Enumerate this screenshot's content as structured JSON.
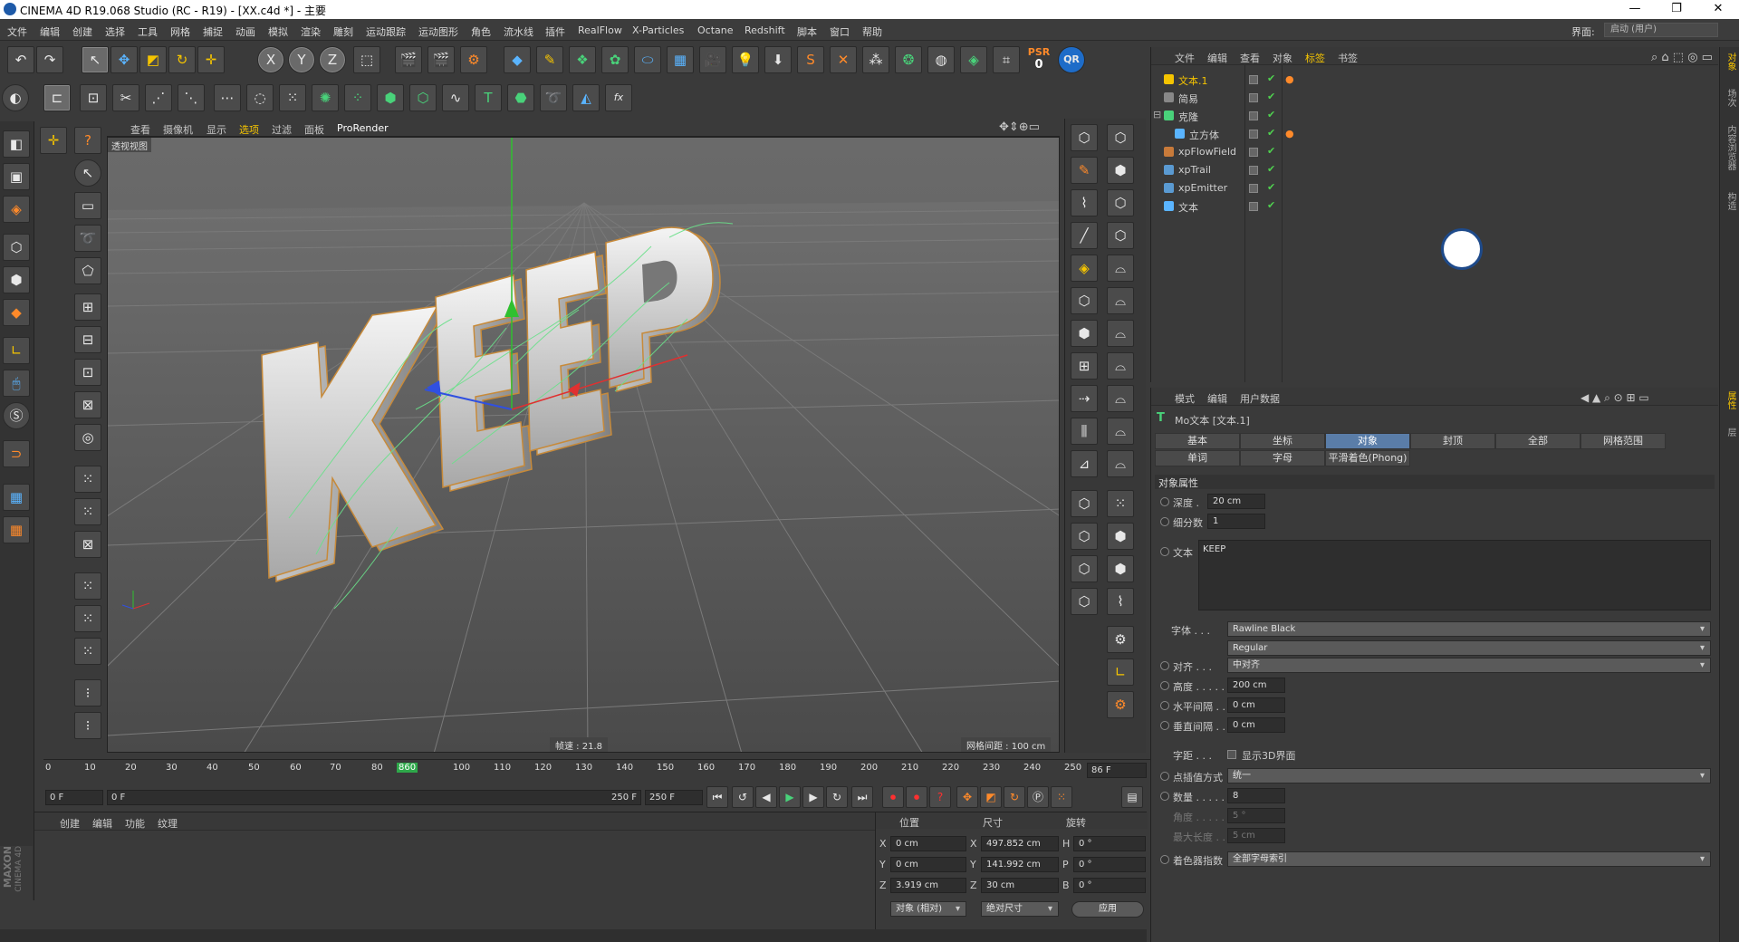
{
  "window": {
    "title": "CINEMA 4D R19.068 Studio (RC - R19) - [XX.c4d *] - 主要"
  },
  "menu": [
    "文件",
    "编辑",
    "创建",
    "选择",
    "工具",
    "网格",
    "捕捉",
    "动画",
    "模拟",
    "渲染",
    "雕刻",
    "运动跟踪",
    "运动图形",
    "角色",
    "流水线",
    "插件",
    "RealFlow",
    "X-Particles",
    "Octane",
    "Redshift",
    "脚本",
    "窗口",
    "帮助"
  ],
  "layout": {
    "label": "界面:",
    "value": "启动 (用户)"
  },
  "toolbar": {
    "psr_label": "PSR",
    "psr_value": "0",
    "qr_label": "QR",
    "x": "X",
    "y": "Y",
    "z": "Z",
    "s": "S",
    "t": "T",
    "fx": "fx"
  },
  "viewport": {
    "menu": [
      "查看",
      "摄像机",
      "显示",
      "选项",
      "过滤",
      "面板",
      "ProRender"
    ],
    "name": "透视视图",
    "fps": "帧速 : 21.8",
    "grid": "网格间距 : 100 cm",
    "text3d": "KEEP"
  },
  "timeline": {
    "ticks": [
      "0",
      "10",
      "20",
      "30",
      "40",
      "50",
      "60",
      "70",
      "80",
      "860",
      "100",
      "110",
      "120",
      "130",
      "140",
      "150",
      "160",
      "170",
      "180",
      "190",
      "200",
      "210",
      "220",
      "230",
      "240",
      "250"
    ],
    "current_frame": "86 F",
    "start": "0 F",
    "range_start": "0 F",
    "range_end": "250 F",
    "end": "250 F"
  },
  "materials": {
    "menu": [
      "创建",
      "编辑",
      "功能",
      "纹理"
    ]
  },
  "brand": {
    "line1": "MAXON",
    "line2": "CINEMA 4D"
  },
  "coords": {
    "headers": [
      "位置",
      "尺寸",
      "旋转"
    ],
    "rows": [
      {
        "pl": "X",
        "pv": "0 cm",
        "sl": "X",
        "sv": "497.852 cm",
        "rl": "H",
        "rv": "0 °"
      },
      {
        "pl": "Y",
        "pv": "0 cm",
        "sl": "Y",
        "sv": "141.992 cm",
        "rl": "P",
        "rv": "0 °"
      },
      {
        "pl": "Z",
        "pv": "3.919 cm",
        "sl": "Z",
        "sv": "30 cm",
        "rl": "B",
        "rv": "0 °"
      }
    ],
    "mode": "对象 (相对)",
    "size_mode": "绝对尺寸",
    "apply": "应用"
  },
  "objects": {
    "menu": [
      "文件",
      "编辑",
      "查看",
      "对象",
      "标签",
      "书签"
    ],
    "rows": [
      {
        "name": "文本.1",
        "highlight": true,
        "color": "#f5c400"
      },
      {
        "name": "简易",
        "highlight": false,
        "color": "#888888"
      },
      {
        "name": "克隆",
        "highlight": false,
        "color": "#49d27a"
      },
      {
        "name": "立方体",
        "highlight": false,
        "color": "#5ab4ff"
      },
      {
        "name": "xpFlowField",
        "highlight": false,
        "color": "#c87a3a"
      },
      {
        "name": "xpTrail",
        "highlight": false,
        "color": "#5a9ad2"
      },
      {
        "name": "xpEmitter",
        "highlight": false,
        "color": "#5a9ad2"
      },
      {
        "name": "文本",
        "highlight": false,
        "color": "#5ab4ff"
      }
    ]
  },
  "attributes": {
    "menu": [
      "模式",
      "编辑",
      "用户数据"
    ],
    "object_title": "Mo文本 [文本.1]",
    "tabs_row1": [
      "基本",
      "坐标",
      "对象",
      "封顶",
      "全部",
      "网格范围"
    ],
    "tabs_row2": [
      "单词",
      "字母",
      "平滑着色(Phong)"
    ],
    "section": "对象属性",
    "depth_label": "深度 .",
    "depth": "20 cm",
    "subdiv_label": "细分数",
    "subdiv": "1",
    "text_label": "文本",
    "text": "KEEP",
    "font_label": "字体 . . .",
    "font": "Rawline Black",
    "font_style": "Regular",
    "align_label": "对齐 . . .",
    "align": "中对齐",
    "height_label": "高度 . . . . .",
    "height": "200 cm",
    "hspace_label": "水平间隔 . .",
    "hspace": "0 cm",
    "vspace_label": "垂直间隔 . .",
    "vspace": "0 cm",
    "kerning_label": "字距 . . .",
    "show3d": "显示3D界面",
    "interp_label": "点插值方式",
    "interp": "统一",
    "count_label": "数量 . . . . .",
    "count": "8",
    "angle_label": "角度 . . . . .",
    "angle": "5 °",
    "maxlen_label": "最大长度 . .",
    "maxlen": "5 cm",
    "shader_label": "着色器指数",
    "shader": "全部字母索引"
  },
  "sidebar_tabs": [
    "对象",
    "场次",
    "内容浏览器",
    "构造"
  ],
  "sidebar_tabs2": [
    "属性",
    "层"
  ],
  "colors": {
    "accent": "#5a7da8",
    "highlight": "#f5c400",
    "axis_x": "#e03030",
    "axis_y": "#30c030",
    "axis_z": "#3050e0"
  }
}
